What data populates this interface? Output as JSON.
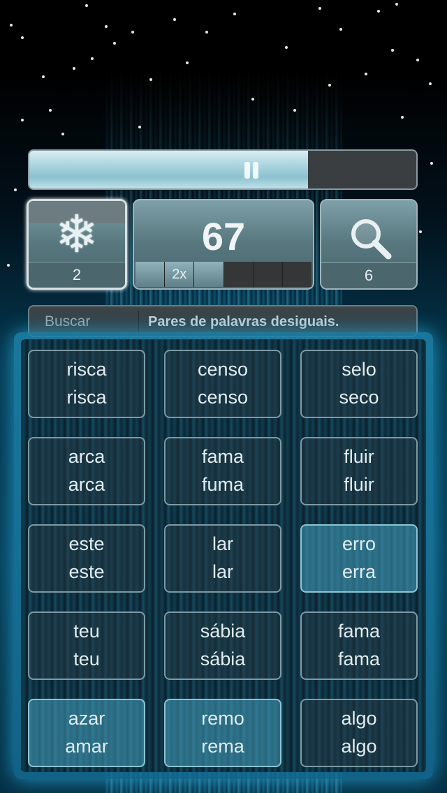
{
  "game": {
    "timer_fill": 0.72,
    "freeze": {
      "icon": "snowflake-icon",
      "count": "2"
    },
    "score": {
      "value": "67",
      "multiplier_label": "2x",
      "multiplier_level": 3,
      "multiplier_slots": 6
    },
    "search": {
      "icon": "magnifier-icon",
      "count": "6"
    },
    "instruction": {
      "label": "Buscar",
      "text": "Pares de palavras desiguais."
    }
  },
  "cards": [
    {
      "w1": "risca",
      "w2": "risca",
      "lit": false
    },
    {
      "w1": "censo",
      "w2": "censo",
      "lit": false
    },
    {
      "w1": "selo",
      "w2": "seco",
      "lit": false
    },
    {
      "w1": "arca",
      "w2": "arca",
      "lit": false
    },
    {
      "w1": "fama",
      "w2": "fuma",
      "lit": false
    },
    {
      "w1": "fluir",
      "w2": "fluir",
      "lit": false
    },
    {
      "w1": "este",
      "w2": "este",
      "lit": false
    },
    {
      "w1": "lar",
      "w2": "lar",
      "lit": false
    },
    {
      "w1": "erro",
      "w2": "erra",
      "lit": true
    },
    {
      "w1": "teu",
      "w2": "teu",
      "lit": false
    },
    {
      "w1": "sábia",
      "w2": "sábia",
      "lit": false
    },
    {
      "w1": "fama",
      "w2": "fama",
      "lit": false
    },
    {
      "w1": "azar",
      "w2": "amar",
      "lit": true
    },
    {
      "w1": "remo",
      "w2": "rema",
      "lit": true
    },
    {
      "w1": "algo",
      "w2": "algo",
      "lit": false
    }
  ]
}
